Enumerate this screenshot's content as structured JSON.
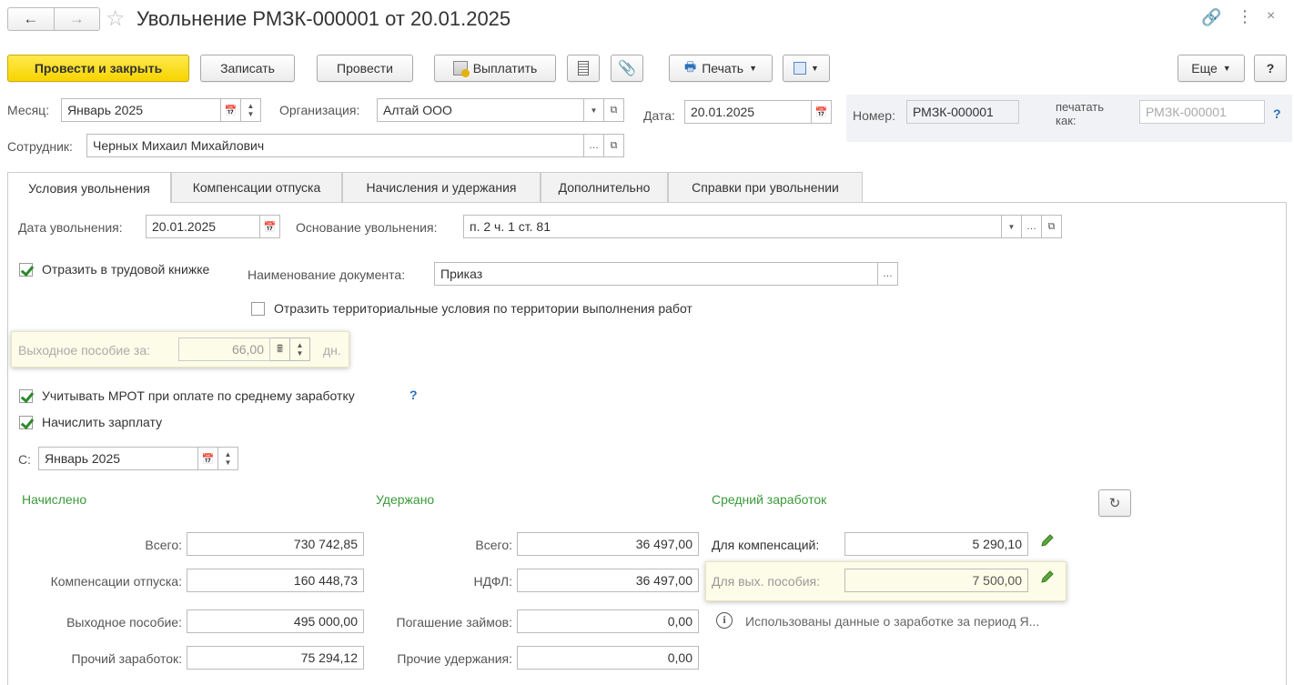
{
  "window": {
    "title": "Увольнение РМЗК-000001 от 20.01.2025"
  },
  "toolbar": {
    "post_close": "Провести и закрыть",
    "save": "Записать",
    "post": "Провести",
    "pay": "Выплатить",
    "print": "Печать",
    "more": "Еще",
    "help": "?"
  },
  "header": {
    "month_label": "Месяц:",
    "month_value": "Январь 2025",
    "org_label": "Организация:",
    "org_value": "Алтай ООО",
    "date_label": "Дата:",
    "date_value": "20.01.2025",
    "number_label": "Номер:",
    "number_value": "РМЗК-000001",
    "print_as_label_1": "печатать",
    "print_as_label_2": "как:",
    "print_as_placeholder": "РМЗК-000001",
    "print_as_help": "?",
    "employee_label": "Сотрудник:",
    "employee_value": "Черных Михаил Михайлович"
  },
  "tabs": [
    {
      "label": "Условия увольнения",
      "active": true
    },
    {
      "label": "Компенсации отпуска",
      "active": false
    },
    {
      "label": "Начисления и удержания",
      "active": false
    },
    {
      "label": "Дополнительно",
      "active": false
    },
    {
      "label": "Справки при увольнении",
      "active": false
    }
  ],
  "conditions": {
    "dismissal_date_label": "Дата увольнения:",
    "dismissal_date_value": "20.01.2025",
    "basis_label": "Основание увольнения:",
    "basis_value": "п. 2 ч. 1 ст. 81",
    "workbook_label": "Отразить в трудовой книжке",
    "workbook_checked": true,
    "doc_name_label": "Наименование документа:",
    "doc_name_value": "Приказ",
    "territorial_label": "Отразить территориальные условия по территории выполнения работ",
    "territorial_checked": false,
    "severance_label": "Выходное пособие за:",
    "severance_value": "66,00",
    "severance_unit": "дн.",
    "mrot_label": "Учитывать МРОТ при оплате по среднему заработку",
    "mrot_checked": true,
    "mrot_help": "?",
    "accrue_label": "Начислить зарплату",
    "accrue_checked": true,
    "from_label": "С:",
    "from_value": "Январь 2025"
  },
  "accrued": {
    "title": "Начислено",
    "total_label": "Всего:",
    "total_value": "730 742,85",
    "vacation_label": "Компенсации отпуска:",
    "vacation_value": "160 448,73",
    "severance_label": "Выходное пособие:",
    "severance_value": "495 000,00",
    "other_label": "Прочий заработок:",
    "other_value": "75 294,12"
  },
  "withheld": {
    "title": "Удержано",
    "total_label": "Всего:",
    "total_value": "36 497,00",
    "ndfl_label": "НДФЛ:",
    "ndfl_value": "36 497,00",
    "loans_label": "Погашение займов:",
    "loans_value": "0,00",
    "other_label": "Прочие удержания:",
    "other_value": "0,00"
  },
  "average": {
    "title": "Средний заработок",
    "comp_label": "Для компенсаций:",
    "comp_value": "5 290,10",
    "sev_label": "Для вых. пособия:",
    "sev_value": "7 500,00",
    "info_text": "Использованы данные о заработке за период Я..."
  },
  "colors": {
    "primary_button": "#f7d400",
    "section_title": "#3a9a3a",
    "help_link": "#2a6fba"
  }
}
